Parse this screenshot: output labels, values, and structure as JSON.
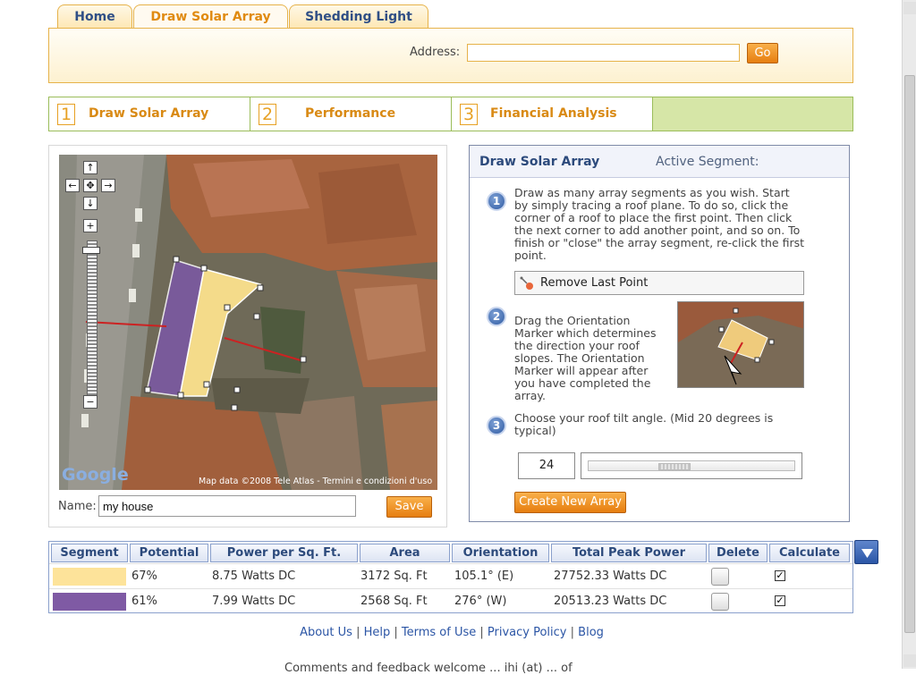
{
  "tabs": [
    {
      "label": "Home"
    },
    {
      "label": "Draw Solar Array"
    },
    {
      "label": "Shedding Light"
    }
  ],
  "address": {
    "label": "Address:",
    "value": "",
    "go_label": "Go"
  },
  "steps": [
    {
      "num": "1",
      "label": "Draw Solar Array"
    },
    {
      "num": "2",
      "label": "Performance"
    },
    {
      "num": "3",
      "label": "Financial Analysis"
    }
  ],
  "map": {
    "copyright": "Map data ©2008 Tele Atlas - Termini e condizioni d'uso",
    "google_logo": "Google",
    "name_label": "Name:",
    "name_value": "my house",
    "save_label": "Save"
  },
  "draw_panel": {
    "title": "Draw Solar Array",
    "active_segment": "Active Segment:",
    "step1_num": "1",
    "step1_text": "Draw as many array segments as you wish. Start by simply tracing a roof plane. To do so, click the corner of a roof to place the first point. Then click the next corner to add another point, and so on. To finish or \"close\" the array segment, re-click the first point.",
    "remove_label": "Remove Last Point",
    "step2_num": "2",
    "step2_text": "Drag the Orientation Marker which determines the direction your roof slopes. The Orientation Marker will appear after you have completed the array.",
    "step3_num": "3",
    "step3_text": "Choose your roof tilt angle. (Mid 20 degrees is typical)",
    "tilt_value": "24",
    "create_label": "Create New Array"
  },
  "table": {
    "headers": [
      "Segment",
      "Potential",
      "Power per Sq. Ft.",
      "Area",
      "Orientation",
      "Total Peak Power",
      "Delete",
      "Calculate"
    ],
    "rows": [
      {
        "color": "#fde39a",
        "potential": "67%",
        "power": "8.75 Watts DC",
        "area": "3172 Sq. Ft",
        "orientation": "105.1° (E)",
        "peak": "27752.33 Watts DC",
        "checked": "✓"
      },
      {
        "color": "#7f5aa4",
        "potential": "61%",
        "power": "7.99 Watts DC",
        "area": "2568 Sq. Ft",
        "orientation": "276° (W)",
        "peak": "20513.23 Watts DC",
        "checked": "✓"
      }
    ]
  },
  "footer": {
    "links": [
      "About Us",
      "Help",
      "Terms of Use",
      "Privacy Policy",
      "Blog"
    ],
    "cut_text": "Comments and feedback welcome ... ihi (at) ... of"
  },
  "colors": {
    "accent_orange": "#e67e10",
    "tab_border": "#e6b24a",
    "step_green": "#d6e6a7",
    "nav_blue": "#2b56a6"
  }
}
